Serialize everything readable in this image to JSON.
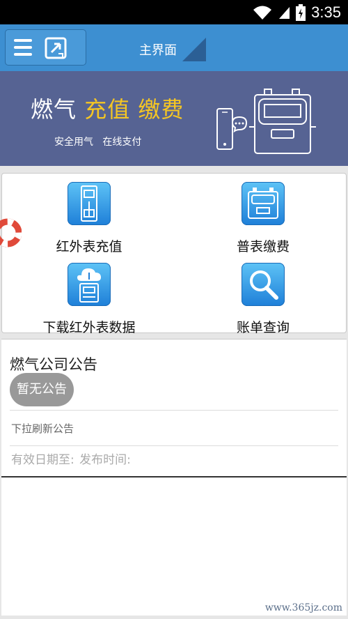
{
  "status_bar": {
    "time": "3:35",
    "icons": [
      "wifi-icon",
      "signal-icon",
      "battery-charging-icon"
    ]
  },
  "header": {
    "title": "主界面",
    "menu_icon": "hamburger-icon",
    "logo_icon": "app-logo-icon"
  },
  "banner": {
    "title_part1": "燃气",
    "title_part2": "充值 缴费",
    "subtitle": "安全用气   在线支付",
    "art_icons": [
      "phone-chat-icon",
      "gas-meter-icon"
    ]
  },
  "menu": {
    "items": [
      {
        "label": "红外表充值",
        "icon": "infrared-meter-icon"
      },
      {
        "label": "普表缴费",
        "icon": "gas-meter-icon"
      },
      {
        "label": "下载红外表数据",
        "icon": "cloud-download-meter-icon"
      },
      {
        "label": "账单查询",
        "icon": "magnifier-icon"
      }
    ],
    "floating_icon": "lifebuoy-icon"
  },
  "notice": {
    "title": "燃气公司公告",
    "empty_label": "暂无公告",
    "refresh_hint": "下拉刷新公告",
    "expiry_label": "有效日期至:",
    "publish_label": "发布时间:"
  },
  "watermark": "www.365jz.com",
  "colors": {
    "header": "#3d8fd1",
    "banner": "#566393",
    "banner_highlight": "#f5c623",
    "tile": "#2b8fe0"
  }
}
